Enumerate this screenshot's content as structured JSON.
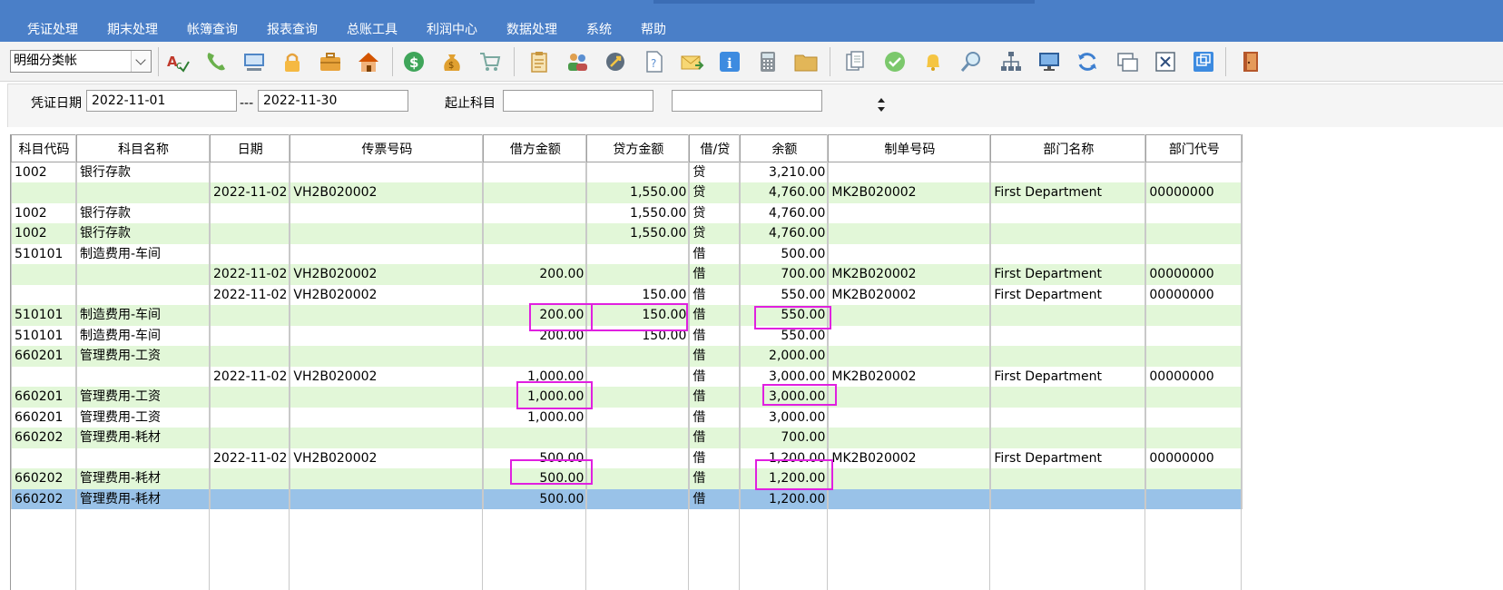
{
  "menu": [
    "凭证处理",
    "期末处理",
    "帐簿查询",
    "报表查询",
    "总账工具",
    "利润中心",
    "数据处理",
    "系统",
    "帮助"
  ],
  "toolbar": {
    "view_select": "明细分类帐",
    "icons": [
      "spellcheck-icon",
      "phone-icon",
      "computer-icon",
      "lock-icon",
      "briefcase-icon",
      "home-icon",
      "dollar-icon",
      "money-bag-icon",
      "cart-icon",
      "clipboard-icon",
      "users-icon",
      "link-icon",
      "help-doc-icon",
      "mail-icon",
      "info-icon",
      "calculator-icon",
      "folder-icon",
      "copy-icon",
      "check-icon",
      "bell-icon",
      "search-icon",
      "org-chart-icon",
      "monitor-icon",
      "refresh-icon",
      "window-icon",
      "close-icon",
      "restore-icon",
      "exit-icon"
    ]
  },
  "filter": {
    "date_label": "凭证日期",
    "date_from": "2022-11-01",
    "date_sep": "---",
    "date_to": "2022-11-30",
    "account_label": "起止科目",
    "account_from": "",
    "account_to": ""
  },
  "grid": {
    "columns": [
      "科目代码",
      "科目名称",
      "日期",
      "传票号码",
      "借方金额",
      "贷方金额",
      "借/贷",
      "余额",
      "制单号码",
      "部门名称",
      "部门代号"
    ],
    "rows": [
      {
        "style": "w",
        "cells": [
          "1002",
          "银行存款",
          "",
          "",
          "",
          "",
          "贷",
          "3,210.00",
          "",
          "",
          ""
        ]
      },
      {
        "style": "g",
        "cells": [
          "",
          "",
          "2022-11-02",
          "VH2B020002",
          "",
          "1,550.00",
          "贷",
          "4,760.00",
          "MK2B020002",
          "First Department",
          "00000000"
        ]
      },
      {
        "style": "w",
        "cells": [
          "1002",
          "银行存款",
          "",
          "",
          "",
          "1,550.00",
          "贷",
          "4,760.00",
          "",
          "",
          ""
        ]
      },
      {
        "style": "g",
        "cells": [
          "1002",
          "银行存款",
          "",
          "",
          "",
          "1,550.00",
          "贷",
          "4,760.00",
          "",
          "",
          ""
        ]
      },
      {
        "style": "w",
        "cells": [
          "510101",
          "制造费用-车间",
          "",
          "",
          "",
          "",
          "借",
          "500.00",
          "",
          "",
          ""
        ]
      },
      {
        "style": "g",
        "cells": [
          "",
          "",
          "2022-11-02",
          "VH2B020002",
          "200.00",
          "",
          "借",
          "700.00",
          "MK2B020002",
          "First Department",
          "00000000"
        ]
      },
      {
        "style": "w",
        "cells": [
          "",
          "",
          "2022-11-02",
          "VH2B020002",
          "",
          "150.00",
          "借",
          "550.00",
          "MK2B020002",
          "First Department",
          "00000000"
        ]
      },
      {
        "style": "g",
        "cells": [
          "510101",
          "制造费用-车间",
          "",
          "",
          "200.00",
          "150.00",
          "借",
          "550.00",
          "",
          "",
          ""
        ]
      },
      {
        "style": "w",
        "cells": [
          "510101",
          "制造费用-车间",
          "",
          "",
          "200.00",
          "150.00",
          "借",
          "550.00",
          "",
          "",
          ""
        ]
      },
      {
        "style": "g",
        "cells": [
          "660201",
          "管理费用-工资",
          "",
          "",
          "",
          "",
          "借",
          "2,000.00",
          "",
          "",
          ""
        ]
      },
      {
        "style": "w",
        "cells": [
          "",
          "",
          "2022-11-02",
          "VH2B020002",
          "1,000.00",
          "",
          "借",
          "3,000.00",
          "MK2B020002",
          "First Department",
          "00000000"
        ]
      },
      {
        "style": "g",
        "cells": [
          "660201",
          "管理费用-工资",
          "",
          "",
          "1,000.00",
          "",
          "借",
          "3,000.00",
          "",
          "",
          ""
        ]
      },
      {
        "style": "w",
        "cells": [
          "660201",
          "管理费用-工资",
          "",
          "",
          "1,000.00",
          "",
          "借",
          "3,000.00",
          "",
          "",
          ""
        ]
      },
      {
        "style": "g",
        "cells": [
          "660202",
          "管理费用-耗材",
          "",
          "",
          "",
          "",
          "借",
          "700.00",
          "",
          "",
          ""
        ]
      },
      {
        "style": "w",
        "cells": [
          "",
          "",
          "2022-11-02",
          "VH2B020002",
          "500.00",
          "",
          "借",
          "1,200.00",
          "MK2B020002",
          "First Department",
          "00000000"
        ]
      },
      {
        "style": "g",
        "cells": [
          "660202",
          "管理费用-耗材",
          "",
          "",
          "500.00",
          "",
          "借",
          "1,200.00",
          "",
          "",
          ""
        ]
      },
      {
        "style": "sel",
        "cells": [
          "660202",
          "管理费用-耗材",
          "",
          "",
          "500.00",
          "",
          "借",
          "1,200.00",
          "",
          "",
          ""
        ]
      }
    ]
  },
  "colors": {
    "menubar": "#4a7fc8",
    "row_green": "#e2f7d8",
    "row_selected": "#99c2e8",
    "highlight": "#e020e0"
  }
}
